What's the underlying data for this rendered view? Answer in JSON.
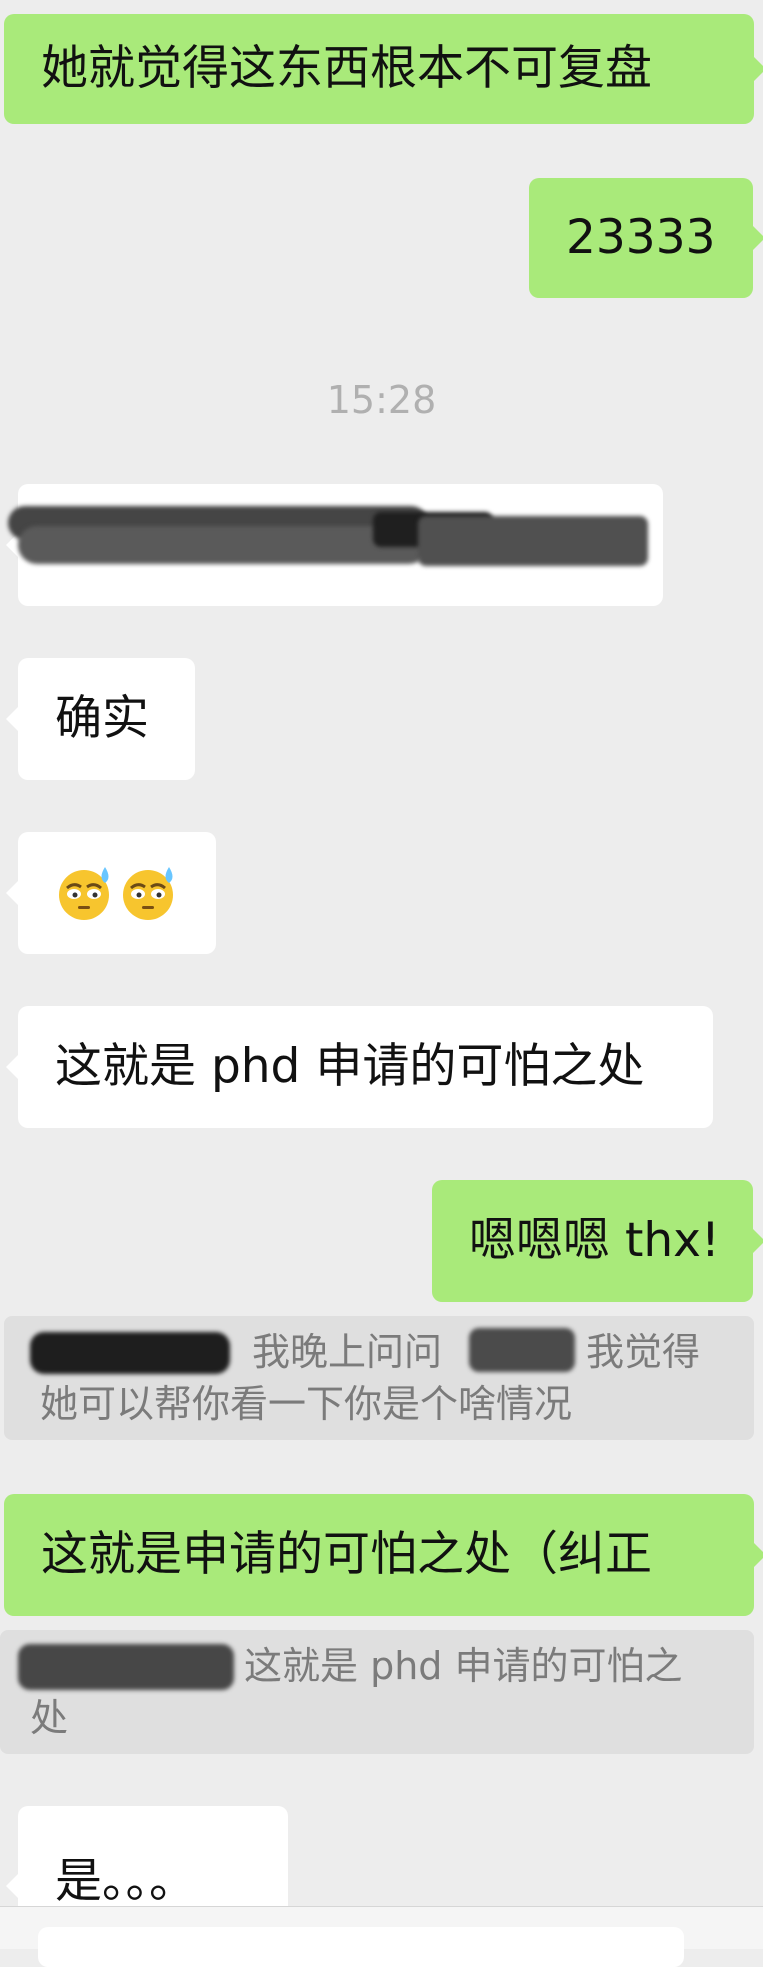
{
  "messages": [
    {
      "sender": "me",
      "text": "她就觉得这东西根本不可复盘"
    },
    {
      "sender": "me",
      "text": "23333"
    },
    {
      "type": "timestamp",
      "text": "15:28"
    },
    {
      "sender": "other",
      "type": "redacted-text",
      "text": ""
    },
    {
      "sender": "other",
      "text": "确实"
    },
    {
      "sender": "other",
      "type": "emoji",
      "emoji_names": [
        "sweat-unamused-face-emoji",
        "sweat-unamused-face-emoji"
      ]
    },
    {
      "sender": "other",
      "text": "这就是 phd 申请的可怕之处"
    },
    {
      "sender": "me",
      "text": "嗯嗯嗯 thx!"
    },
    {
      "type": "quote",
      "parts": [
        "我晚上问问",
        "我觉得",
        "她可以帮你看一下你是个啥情况"
      ]
    },
    {
      "sender": "me",
      "text": "这就是申请的可怕之处（纠正"
    },
    {
      "type": "quote",
      "parts": [
        "这就是 phd 申请的可怕之",
        "处"
      ]
    },
    {
      "sender": "other",
      "text": "是。。。"
    }
  ],
  "colors": {
    "sent_bubble": "#a9ea7a",
    "received_bubble": "#ffffff",
    "background": "#ededed",
    "quote_background": "#dfdfdf",
    "quote_text": "#7b7b7b",
    "timestamp_text": "#b0b0b0"
  }
}
